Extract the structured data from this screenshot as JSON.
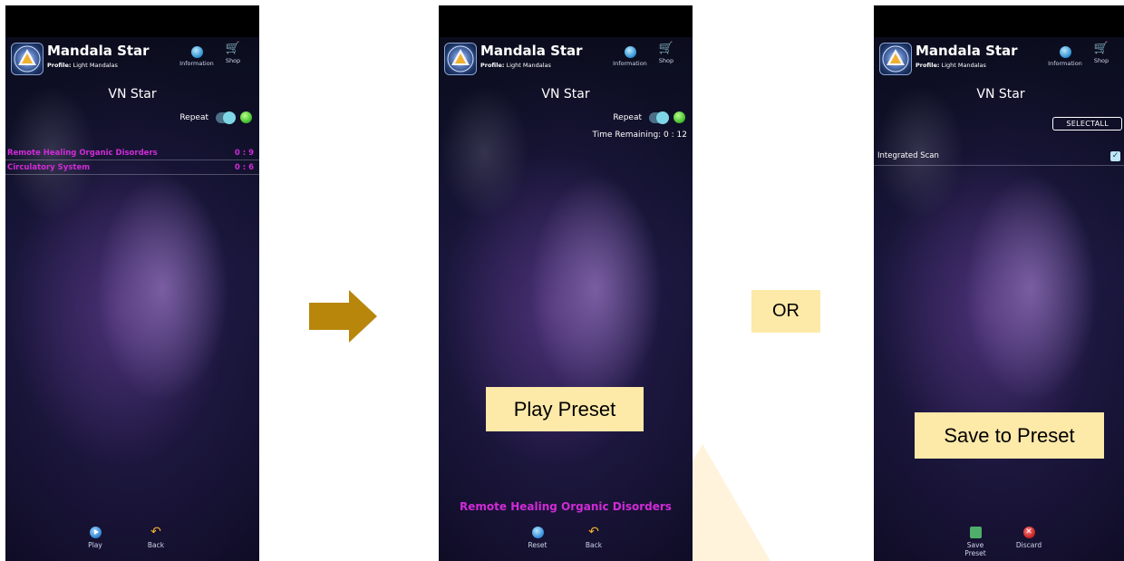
{
  "app": {
    "title": "Mandala Star",
    "profile_key": "Profile:",
    "profile_value": "Light Mandalas",
    "info_label": "Information",
    "shop_label": "Shop",
    "preset_title": "VN Star"
  },
  "screen1": {
    "repeat_label": "Repeat",
    "items": [
      {
        "name": "Remote Healing Organic Disorders",
        "time": "0 : 9"
      },
      {
        "name": "Circulatory System",
        "time": "0 : 6"
      }
    ],
    "play_label": "Play",
    "back_label": "Back"
  },
  "screen2": {
    "repeat_label": "Repeat",
    "time_remaining": "Time Remaining: 0 : 12",
    "now_playing": "Remote Healing Organic Disorders",
    "reset_label": "Reset",
    "back_label": "Back",
    "callout": "Play Preset"
  },
  "screen3": {
    "select_all": "SELECTALL",
    "item_label": "Integrated Scan",
    "item_checked": true,
    "save_label": "Save Preset",
    "discard_label": "Discard",
    "callout": "Save to Preset"
  },
  "or_label": "OR",
  "colors": {
    "accent_magenta": "#d02bd7",
    "callout_bg": "#fde9a8",
    "arrow": "#b8860b"
  },
  "icons": [
    "app-logo-icon",
    "information-icon",
    "shop-cart-icon",
    "play-icon",
    "back-arrow-icon",
    "reset-icon",
    "save-preset-icon",
    "discard-icon",
    "checkbox-icon",
    "right-arrow-icon"
  ]
}
